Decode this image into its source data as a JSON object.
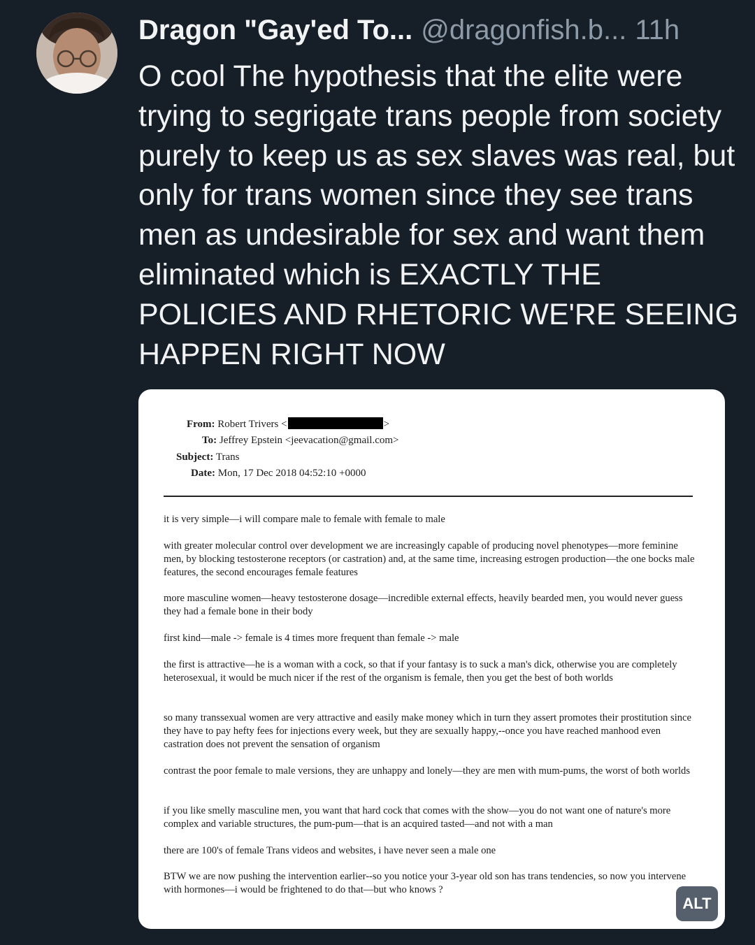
{
  "post": {
    "display_name": "Dragon \"Gay'ed To...",
    "handle": "@dragonfish.b...",
    "time": "11h",
    "text": "O cool The hypothesis that the elite were trying to segrigate trans people from society purely to keep us as sex slaves was real, but only for trans women since they see trans men as undesirable for sex and want them eliminated which is EXACTLY THE POLICIES AND RHETORIC WE'RE SEEING HAPPEN RIGHT NOW",
    "alt_label": "ALT"
  },
  "email": {
    "from_label": "From:",
    "from_value": "Robert Trivers <",
    "from_close": ">",
    "to_label": "To:",
    "to_value": "Jeffrey Epstein <jeevacation@gmail.com>",
    "subject_label": "Subject:",
    "subject_value": "Trans",
    "date_label": "Date:",
    "date_value": "Mon, 17 Dec 2018 04:52:10 +0000",
    "paragraphs": [
      "it is very simple—i will compare male to female with female to male",
      "with greater molecular control over development we are increasingly capable of producing novel phenotypes—more feminine men, by blocking testosterone receptors (or castration) and, at the same time, increasing estrogen production—the one bocks male features, the second encourages female features",
      "more masculine women—heavy testosterone dosage—incredible external effects, heavily bearded men, you would never guess they had a female bone in their body",
      "first kind—male -> female is 4 times more frequent than female -> male",
      "the first is attractive—he is a woman with a cock, so that if your fantasy is to suck a man's dick, otherwise you are completely heterosexual, it would be much nicer if the rest of the organism is female, then you get the best of both worlds",
      "so many transsexual women are very attractive and easily make money which in turn they assert promotes their prostitution since they have to pay hefty fees for injections every week, but they are sexually happy,--once you have reached manhood even castration does not prevent the sensation of organism",
      "contrast the poor female to male versions, they are unhappy and lonely—they are men with mum-pums, the worst of both worlds",
      "if you like smelly masculine men, you want that hard cock that comes with the show—you do not want one of nature's more complex and variable structures, the pum-pum—that is an acquired tasted—and not with a man",
      "there are 100's of female Trans videos and websites, i have never seen a male one",
      "BTW we are now pushing the intervention earlier--so you notice your 3-year old son has trans tendencies, so now you intervene with hormones—i would be frightened to do that—but who knows ?"
    ]
  }
}
